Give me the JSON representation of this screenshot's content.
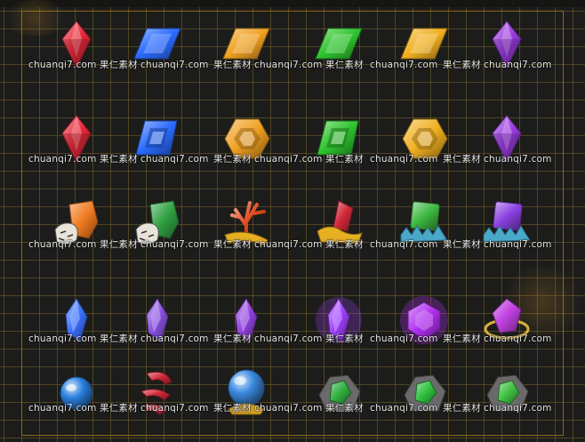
{
  "watermark": {
    "site": "chuanqi7.com",
    "brand": "果仁素材"
  },
  "rows": [
    {
      "row": 1,
      "icons": [
        {
          "name": "red-gem-icon",
          "color": "#e8283a"
        },
        {
          "name": "blue-gem-icon",
          "color": "#2a6bff"
        },
        {
          "name": "orange-gem-icon",
          "color": "#f0a020"
        },
        {
          "name": "green-gem-icon",
          "color": "#2ec42e"
        },
        {
          "name": "gold-gem-icon",
          "color": "#f0b020"
        },
        {
          "name": "purple-gem-icon",
          "color": "#9a3ce0"
        }
      ]
    },
    {
      "row": 2,
      "icons": [
        {
          "name": "red-cut-gem-icon",
          "color": "#e8283a"
        },
        {
          "name": "blue-cut-gem-icon",
          "color": "#2a6bff"
        },
        {
          "name": "orange-cut-gem-icon",
          "color": "#f0a020"
        },
        {
          "name": "green-cut-gem-icon",
          "color": "#2ec42e"
        },
        {
          "name": "gold-cut-gem-icon",
          "color": "#f0b020"
        },
        {
          "name": "purple-cut-gem-icon",
          "color": "#9a3ce0"
        }
      ]
    },
    {
      "row": 3,
      "icons": [
        {
          "name": "tiger-orange-crystal-icon",
          "color": "#f07a20"
        },
        {
          "name": "tiger-green-crystal-icon",
          "color": "#2ea040"
        },
        {
          "name": "red-coral-icon",
          "color": "#e0481c"
        },
        {
          "name": "red-crystal-gold-wing-icon",
          "color": "#d02838"
        },
        {
          "name": "green-crystal-ice-base-icon",
          "color": "#3cb840"
        },
        {
          "name": "purple-crystal-ice-base-icon",
          "color": "#8a40e0"
        }
      ]
    },
    {
      "row": 4,
      "icons": [
        {
          "name": "blue-shard-icon",
          "color": "#3a70ff"
        },
        {
          "name": "violet-shard-icon",
          "color": "#8850e0"
        },
        {
          "name": "purple-shard-icon",
          "color": "#9040e0"
        },
        {
          "name": "purple-glow-shard-icon",
          "color": "#a040ff"
        },
        {
          "name": "purple-orb-gem-icon",
          "color": "#b030f0"
        },
        {
          "name": "purple-ring-gem-icon",
          "color": "#c040e0"
        }
      ]
    },
    {
      "row": 5,
      "icons": [
        {
          "name": "blue-orb-icon",
          "color": "#2a80e0"
        },
        {
          "name": "red-claw-icon",
          "color": "#d02838"
        },
        {
          "name": "crystal-ball-icon",
          "color": "#3a8ae0"
        },
        {
          "name": "green-ore-icon",
          "color": "#30b040"
        },
        {
          "name": "green-ore-large-icon",
          "color": "#30c040"
        },
        {
          "name": "green-crystal-rock-icon",
          "color": "#40c040"
        }
      ]
    }
  ]
}
